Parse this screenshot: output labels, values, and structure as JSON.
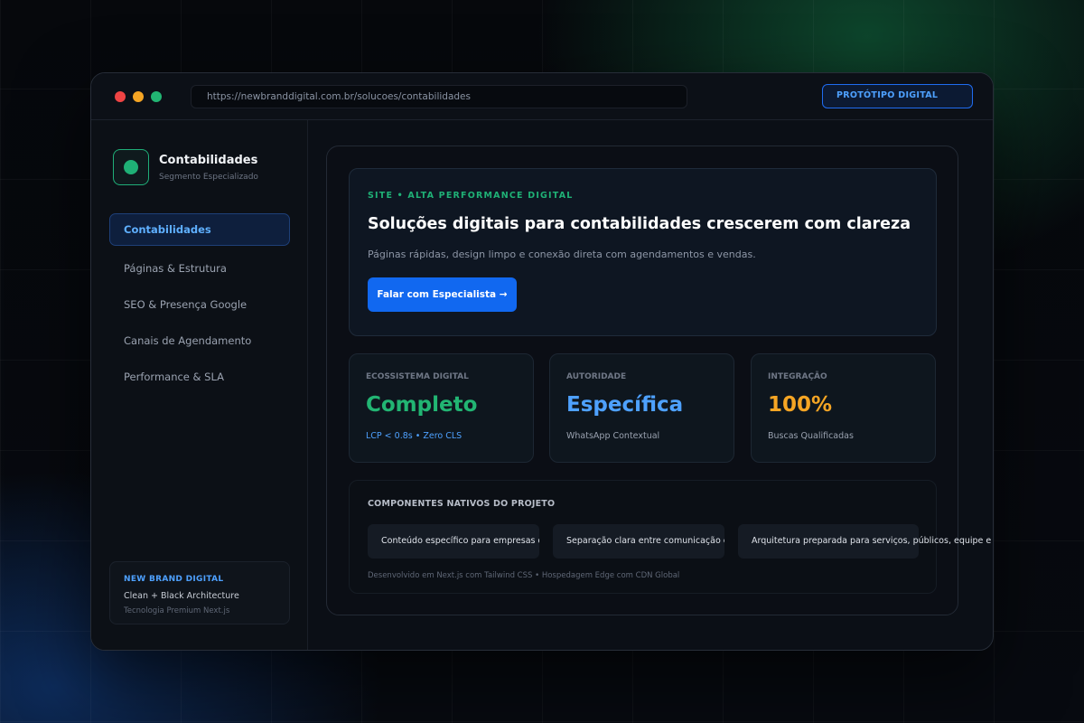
{
  "browser": {
    "url": "https://newbranddigital.com.br/solucoes/contabilidades",
    "badge": "PROTÓTIPO DIGITAL"
  },
  "sidebar": {
    "brand_title": "Contabilidades",
    "brand_subtitle": "Segmento Especializado",
    "items": [
      {
        "label": "Contabilidades",
        "active": true
      },
      {
        "label": "Páginas & Estrutura"
      },
      {
        "label": "SEO & Presença Google"
      },
      {
        "label": "Canais de Agendamento"
      },
      {
        "label": "Performance & SLA"
      }
    ],
    "footer": {
      "title": "NEW BRAND DIGITAL",
      "line1": "Clean + Black Architecture",
      "line2": "Tecnologia Premium Next.js"
    }
  },
  "hero": {
    "eyebrow": "SITE • ALTA PERFORMANCE DIGITAL",
    "title": "Soluções digitais para contabilidades crescerem com clareza",
    "subtitle": "Páginas rápidas, design limpo e conexão direta com agendamentos e vendas.",
    "cta": "Falar com Especialista →"
  },
  "stats": [
    {
      "label": "ECOSSISTEMA DIGITAL",
      "value": "Completo",
      "sub": "LCP < 0.8s • Zero CLS",
      "color": "#22b573",
      "sub_color": "#4ea1ff"
    },
    {
      "label": "AUTORIDADE",
      "value": "Específica",
      "sub": "WhatsApp Contextual",
      "color": "#4ea1ff",
      "sub_color": "#9aa2b0"
    },
    {
      "label": "INTEGRAÇÃO",
      "value": "100%",
      "sub": "Buscas Qualificadas",
      "color": "#f5a524",
      "sub_color": "#9aa2b0"
    }
  ],
  "components": {
    "title": "COMPONENTES NATIVOS DO PROJETO",
    "chips": [
      "Conteúdo específico para empresas que",
      "Separação clara entre comunicação com",
      "Arquitetura preparada para serviços, públicos, equipe e unidades"
    ],
    "footnote": "Desenvolvido em Next.js com Tailwind CSS • Hospedagem Edge com CDN Global"
  },
  "colors": {
    "accent_blue": "#1168f0",
    "accent_green": "#22b573",
    "accent_orange": "#f5a524"
  }
}
